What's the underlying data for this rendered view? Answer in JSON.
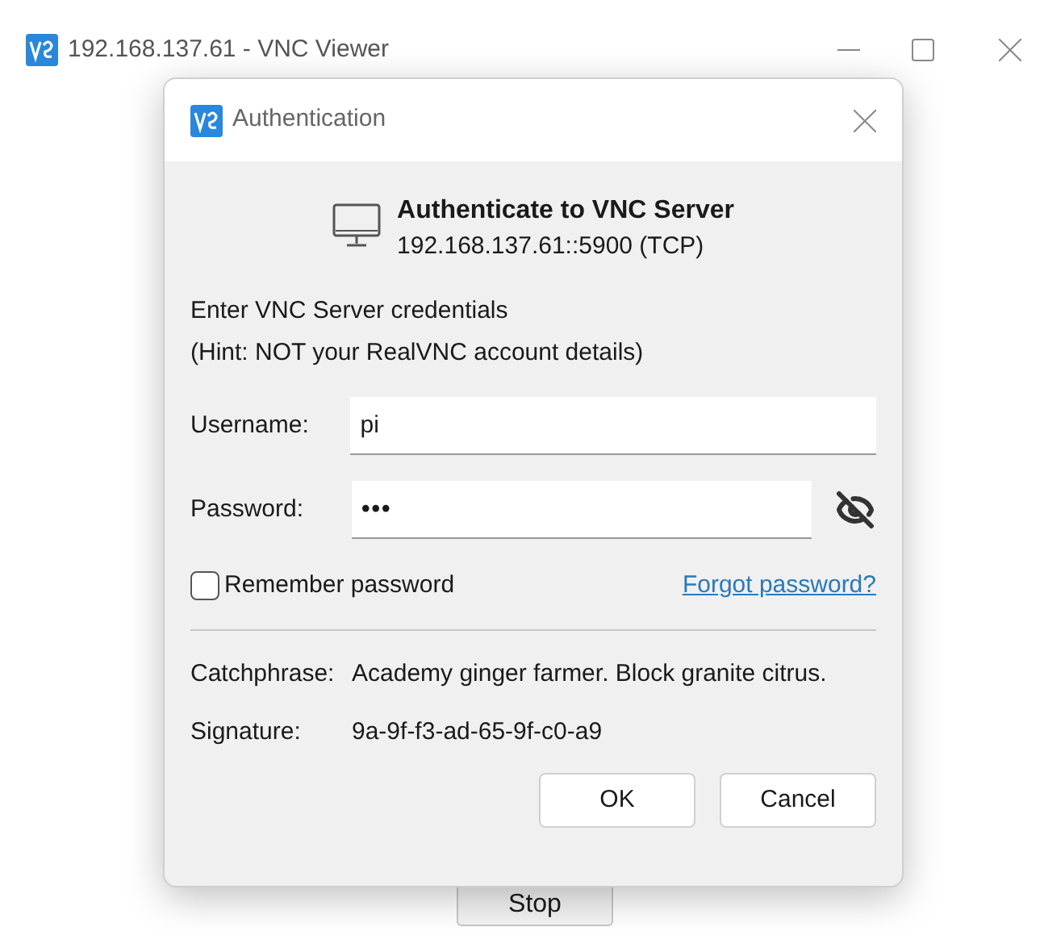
{
  "window": {
    "title": "192.168.137.61 - VNC Viewer"
  },
  "main_button": {
    "label": "Stop"
  },
  "dialog": {
    "title": "Authentication",
    "heading": "Authenticate to VNC Server",
    "address": "192.168.137.61::5900 (TCP)",
    "instructions": [
      "Enter VNC Server credentials",
      "(Hint: NOT your RealVNC account details)"
    ],
    "fields": [
      {
        "label": "Username:",
        "value": "pi",
        "kind": "text"
      },
      {
        "label": "Password:",
        "value": "•••",
        "kind": "password"
      }
    ],
    "remember": {
      "label": "Remember password",
      "checked": false
    },
    "forgot_link": "Forgot password?",
    "info": [
      {
        "label": "Catchphrase:",
        "value": "Academy ginger farmer. Block granite citrus."
      },
      {
        "label": "Signature:",
        "value": "9a-9f-f3-ad-65-9f-c0-a9"
      }
    ],
    "buttons": [
      "OK",
      "Cancel"
    ]
  }
}
